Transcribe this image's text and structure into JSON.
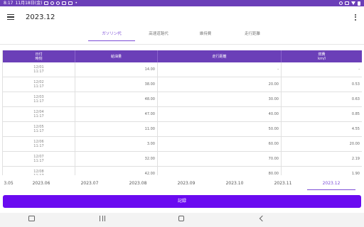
{
  "status_bar": {
    "time": "8:17",
    "date": "11月18日(金)"
  },
  "app_bar": {
    "title": "2023.12"
  },
  "tabs": [
    {
      "label": "ガソリン代",
      "active": true
    },
    {
      "label": "高速道路代",
      "active": false
    },
    {
      "label": "維持費",
      "active": false
    },
    {
      "label": "走行距離",
      "active": false
    }
  ],
  "table": {
    "headers": {
      "date": [
        "日付",
        "時刻"
      ],
      "fuel": "給油量",
      "distance": "走行距離",
      "efficiency": [
        "燃費",
        "km/l"
      ]
    },
    "rows": [
      {
        "date": "12/01",
        "time": "11:17",
        "fuel": "14.00",
        "distance": "-",
        "efficiency": "-"
      },
      {
        "date": "12/02",
        "time": "11:17",
        "fuel": "38.00",
        "distance": "20.00",
        "efficiency": "0.53"
      },
      {
        "date": "12/03",
        "time": "11:17",
        "fuel": "48.00",
        "distance": "30.00",
        "efficiency": "0.63"
      },
      {
        "date": "12/04",
        "time": "11:17",
        "fuel": "47.00",
        "distance": "40.00",
        "efficiency": "0.85"
      },
      {
        "date": "12/05",
        "time": "11:17",
        "fuel": "11.00",
        "distance": "50.00",
        "efficiency": "4.55"
      },
      {
        "date": "12/06",
        "time": "11:17",
        "fuel": "3.00",
        "distance": "60.00",
        "efficiency": "20.00"
      },
      {
        "date": "12/07",
        "time": "11:17",
        "fuel": "32.00",
        "distance": "70.00",
        "efficiency": "2.19"
      },
      {
        "date": "12/08",
        "time": "11:17",
        "fuel": "42.00",
        "distance": "80.00",
        "efficiency": "1.90"
      }
    ]
  },
  "months": [
    {
      "label": "3.05",
      "active": false
    },
    {
      "label": "2023.06",
      "active": false
    },
    {
      "label": "2023.07",
      "active": false
    },
    {
      "label": "2023.08",
      "active": false
    },
    {
      "label": "2023.09",
      "active": false
    },
    {
      "label": "2023.10",
      "active": false
    },
    {
      "label": "2023.11",
      "active": false
    },
    {
      "label": "2023.12",
      "active": true
    }
  ],
  "record_button": {
    "label": "記録"
  },
  "colors": {
    "accent": "#6b3fb8",
    "button": "#6a0af0",
    "tab_active": "#7a4bd6"
  }
}
